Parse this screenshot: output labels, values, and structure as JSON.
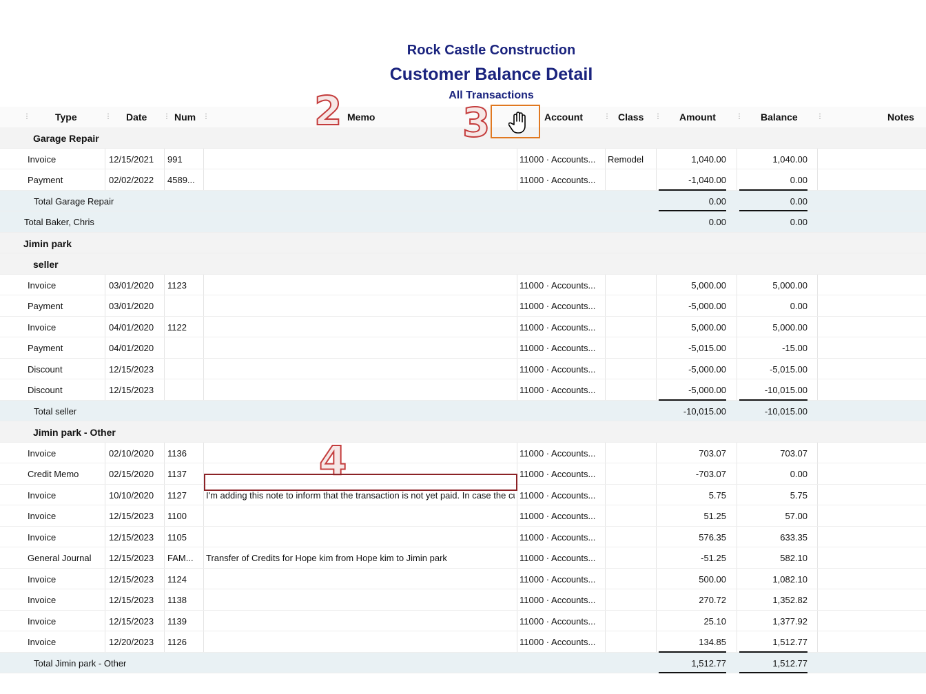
{
  "report": {
    "company": "Rock Castle Construction",
    "title": "Customer Balance Detail",
    "subtitle": "All Transactions"
  },
  "columns": {
    "type": "Type",
    "date": "Date",
    "num": "Num",
    "memo": "Memo",
    "account": "Account",
    "class": "Class",
    "amount": "Amount",
    "balance": "Balance",
    "notes": "Notes"
  },
  "annotations": {
    "a2": "2",
    "a3": "3",
    "a4": "4"
  },
  "icons": {
    "hand": "hand-cursor-icon"
  },
  "rows": [
    {
      "kind": "group",
      "indent": 1,
      "label": "Garage Repair"
    },
    {
      "kind": "data",
      "type": "Invoice",
      "date": "12/15/2021",
      "num": "991",
      "memo": "",
      "account": "11000 · Accounts...",
      "class": "Remodel",
      "amount": "1,040.00",
      "balance": "1,040.00"
    },
    {
      "kind": "data",
      "type": "Payment",
      "date": "02/02/2022",
      "num": "4589...",
      "memo": "",
      "account": "11000 · Accounts...",
      "class": "",
      "amount": "-1,040.00",
      "balance": "0.00",
      "underline": true
    },
    {
      "kind": "total",
      "indent": 1,
      "label": "Total Garage Repair",
      "amount": "0.00",
      "balance": "0.00",
      "underline": true
    },
    {
      "kind": "total",
      "indent": 0,
      "label": "Total Baker, Chris",
      "amount": "0.00",
      "balance": "0.00"
    },
    {
      "kind": "group",
      "indent": 0,
      "label": "Jimin park"
    },
    {
      "kind": "group",
      "indent": 1,
      "label": "seller"
    },
    {
      "kind": "data",
      "type": "Invoice",
      "date": "03/01/2020",
      "num": "1123",
      "memo": "",
      "account": "11000 · Accounts...",
      "class": "",
      "amount": "5,000.00",
      "balance": "5,000.00"
    },
    {
      "kind": "data",
      "type": "Payment",
      "date": "03/01/2020",
      "num": "",
      "memo": "",
      "account": "11000 · Accounts...",
      "class": "",
      "amount": "-5,000.00",
      "balance": "0.00"
    },
    {
      "kind": "data",
      "type": "Invoice",
      "date": "04/01/2020",
      "num": "1122",
      "memo": "",
      "account": "11000 · Accounts...",
      "class": "",
      "amount": "5,000.00",
      "balance": "5,000.00"
    },
    {
      "kind": "data",
      "type": "Payment",
      "date": "04/01/2020",
      "num": "",
      "memo": "",
      "account": "11000 · Accounts...",
      "class": "",
      "amount": "-5,015.00",
      "balance": "-15.00"
    },
    {
      "kind": "data",
      "type": "Discount",
      "date": "12/15/2023",
      "num": "",
      "memo": "",
      "account": "11000 · Accounts...",
      "class": "",
      "amount": "-5,000.00",
      "balance": "-5,015.00"
    },
    {
      "kind": "data",
      "type": "Discount",
      "date": "12/15/2023",
      "num": "",
      "memo": "",
      "account": "11000 · Accounts...",
      "class": "",
      "amount": "-5,000.00",
      "balance": "-10,015.00",
      "underline": true
    },
    {
      "kind": "total",
      "indent": 1,
      "label": "Total seller",
      "amount": "-10,015.00",
      "balance": "-10,015.00"
    },
    {
      "kind": "group",
      "indent": 1,
      "label": "Jimin park - Other"
    },
    {
      "kind": "data",
      "type": "Invoice",
      "date": "02/10/2020",
      "num": "1136",
      "memo": "",
      "account": "11000 · Accounts...",
      "class": "",
      "amount": "703.07",
      "balance": "703.07"
    },
    {
      "kind": "data",
      "type": "Credit Memo",
      "date": "02/15/2020",
      "num": "1137",
      "memo": "",
      "account": "11000 · Accounts...",
      "class": "",
      "amount": "-703.07",
      "balance": "0.00"
    },
    {
      "kind": "data",
      "type": "Invoice",
      "date": "10/10/2020",
      "num": "1127",
      "memo": "I'm adding this note to inform that the transaction is not yet paid. In case the cust...",
      "account": "11000 · Accounts...",
      "class": "",
      "amount": "5.75",
      "balance": "5.75"
    },
    {
      "kind": "data",
      "type": "Invoice",
      "date": "12/15/2023",
      "num": "1100",
      "memo": "",
      "account": "11000 · Accounts...",
      "class": "",
      "amount": "51.25",
      "balance": "57.00"
    },
    {
      "kind": "data",
      "type": "Invoice",
      "date": "12/15/2023",
      "num": "1105",
      "memo": "",
      "account": "11000 · Accounts...",
      "class": "",
      "amount": "576.35",
      "balance": "633.35"
    },
    {
      "kind": "data",
      "type": "General Journal",
      "date": "12/15/2023",
      "num": "FAM...",
      "memo": "Transfer of Credits for Hope kim from Hope kim to Jimin park",
      "account": "11000 · Accounts...",
      "class": "",
      "amount": "-51.25",
      "balance": "582.10"
    },
    {
      "kind": "data",
      "type": "Invoice",
      "date": "12/15/2023",
      "num": "1124",
      "memo": "",
      "account": "11000 · Accounts...",
      "class": "",
      "amount": "500.00",
      "balance": "1,082.10"
    },
    {
      "kind": "data",
      "type": "Invoice",
      "date": "12/15/2023",
      "num": "1138",
      "memo": "",
      "account": "11000 · Accounts...",
      "class": "",
      "amount": "270.72",
      "balance": "1,352.82"
    },
    {
      "kind": "data",
      "type": "Invoice",
      "date": "12/15/2023",
      "num": "1139",
      "memo": "",
      "account": "11000 · Accounts...",
      "class": "",
      "amount": "25.10",
      "balance": "1,377.92"
    },
    {
      "kind": "data",
      "type": "Invoice",
      "date": "12/20/2023",
      "num": "1126",
      "memo": "",
      "account": "11000 · Accounts...",
      "class": "",
      "amount": "134.85",
      "balance": "1,512.77",
      "underline": true
    },
    {
      "kind": "total",
      "indent": 1,
      "label": "Total Jimin park - Other",
      "amount": "1,512.77",
      "balance": "1,512.77",
      "underline": true
    }
  ]
}
